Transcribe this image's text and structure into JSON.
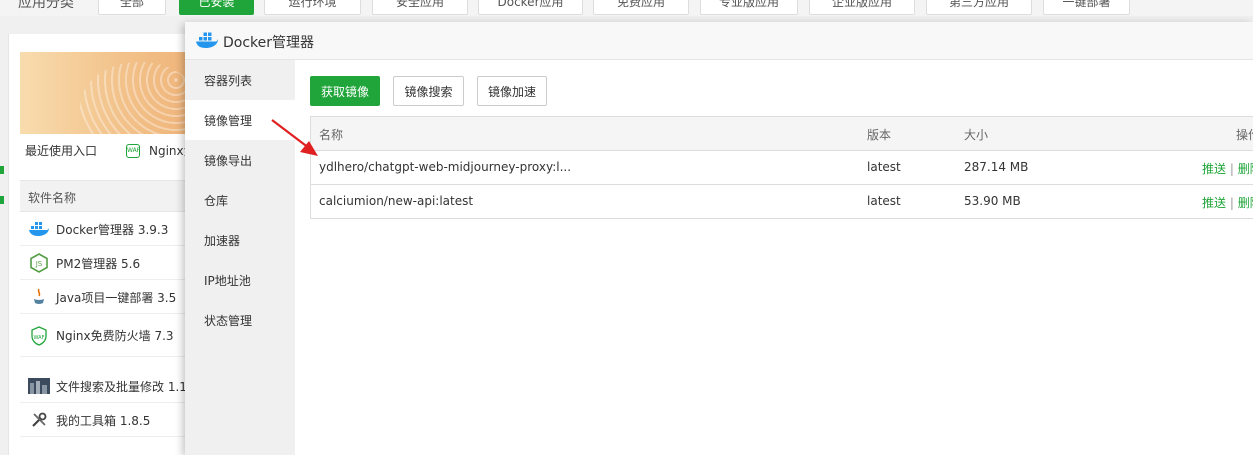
{
  "background": {
    "category_label": "应用分类",
    "categories": [
      "全部",
      "已安装",
      "运行环境",
      "安全应用",
      "Docker应用",
      "免费应用",
      "专业版应用",
      "企业版应用",
      "第三方应用",
      "一键部署"
    ],
    "active_category": "已安装",
    "recent_label": "最近使用入口",
    "recent_app": "Nginx免",
    "table_header": "软件名称",
    "software": [
      {
        "name": "Docker管理器 3.9.3",
        "icon": "docker-icon"
      },
      {
        "name": "PM2管理器 5.6",
        "icon": "nodejs-icon"
      },
      {
        "name": "Java项目一键部署 3.5",
        "icon": "java-icon"
      },
      {
        "name": "Nginx免费防火墙 7.3",
        "icon": "waf-icon"
      },
      {
        "name": "文件搜索及批量修改 1.1",
        "icon": "file-search-icon"
      },
      {
        "name": "我的工具箱 1.8.5",
        "icon": "toolbox-icon"
      }
    ]
  },
  "modal": {
    "title": "Docker管理器",
    "menu": [
      "容器列表",
      "镜像管理",
      "镜像导出",
      "仓库",
      "加速器",
      "IP地址池",
      "状态管理"
    ],
    "active_menu": "镜像管理",
    "toolbar": {
      "get_image": "获取镜像",
      "search_image": "镜像搜索",
      "accelerate": "镜像加速"
    },
    "table": {
      "headers": {
        "name": "名称",
        "version": "版本",
        "size": "大小",
        "ops": "操作"
      },
      "rows": [
        {
          "name": "ydlhero/chatgpt-web-midjourney-proxy:l...",
          "version": "latest",
          "size": "287.14 MB"
        },
        {
          "name": "calciumion/new-api:latest",
          "version": "latest",
          "size": "53.90 MB"
        }
      ],
      "op_push": "推送",
      "op_sep": "|",
      "op_delete": "删除"
    }
  },
  "colors": {
    "accent": "#20a53a",
    "annotation_arrow": "#e02020"
  }
}
